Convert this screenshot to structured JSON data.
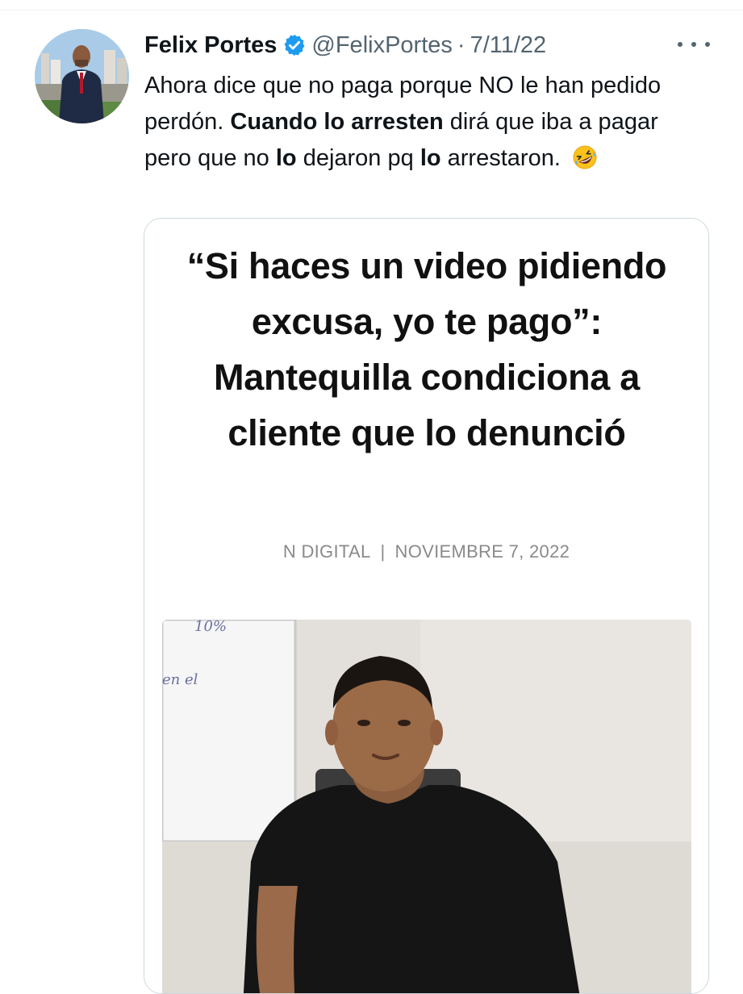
{
  "tweet": {
    "author": {
      "display_name": "Felix Portes",
      "handle": "@FelixPortes",
      "verified": true
    },
    "separator": "·",
    "date": "7/11/22",
    "text": {
      "p1": "Ahora dice que no paga porque NO le han pedido perdón. ",
      "b1": "Cuando lo arresten",
      "p2": " dirá que iba a pagar pero que no ",
      "b2": "lo",
      "p3": " dejaron pq ",
      "b3": "lo",
      "p4": " arrestaron. "
    },
    "emoji": "rolling-on-the-floor-laughing-icon"
  },
  "card": {
    "headline": "“Si haces un video pidiendo excusa, yo te pago”: Mantequilla condiciona a cliente que lo denunció",
    "byline": {
      "source": "N DIGITAL",
      "separator": "|",
      "date": "NOVIEMBRE 7, 2022"
    },
    "photo": {
      "whiteboard_line1": "10%",
      "whiteboard_line2": "en el"
    }
  },
  "colors": {
    "text_primary": "#0f1419",
    "text_secondary": "#536471",
    "verified_blue": "#1d9bf0",
    "border": "#cfd9de"
  }
}
